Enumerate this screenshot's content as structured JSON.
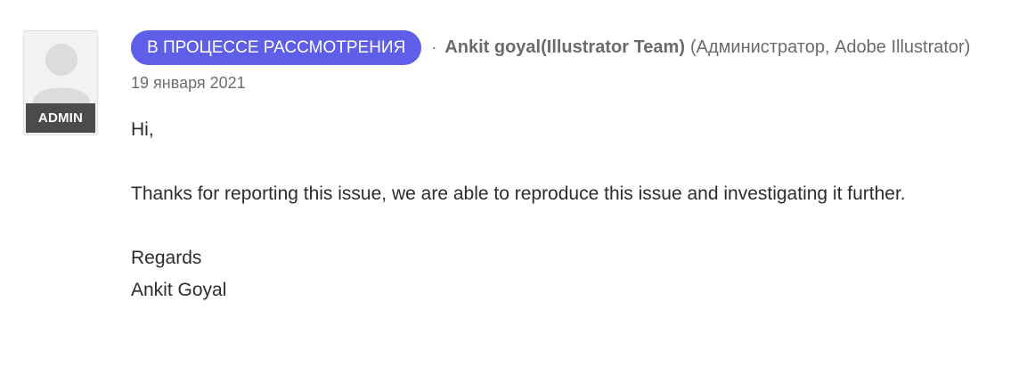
{
  "post": {
    "status_label": "В ПРОЦЕССЕ РАССМОТРЕНИЯ",
    "separator": "·",
    "author_name": "Ankit goyal(Illustrator Team)",
    "author_role": "(Администратор, Adobe Illustrator)",
    "date": "19 января 2021",
    "avatar": {
      "icon": "user-silhouette-icon",
      "badge": "ADMIN"
    },
    "body": {
      "greeting": "Hi,",
      "message": "Thanks for reporting this issue, we are able to reproduce this issue and investigating it further.",
      "closing": "Regards",
      "signature": "Ankit Goyal"
    }
  },
  "colors": {
    "status_pill": "#5e5ee8",
    "admin_badge": "#4b4b4b",
    "meta_text": "#6b6b6b",
    "body_text": "#2c2c2c"
  }
}
